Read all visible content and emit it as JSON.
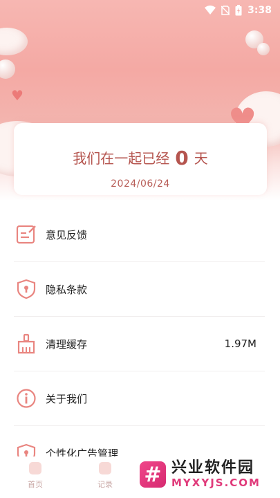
{
  "status_bar": {
    "time": "3:38"
  },
  "hero": {
    "together_prefix": "我们在一起已经",
    "days_count": "0",
    "together_suffix": "天",
    "start_date": "2024/06/24"
  },
  "menu": [
    {
      "label": "意见反馈",
      "icon": "feedback-edit-icon",
      "value": ""
    },
    {
      "label": "隐私条款",
      "icon": "privacy-shield-icon",
      "value": ""
    },
    {
      "label": "清理缓存",
      "icon": "broom-icon",
      "value": "1.97M"
    },
    {
      "label": "关于我们",
      "icon": "info-icon",
      "value": ""
    },
    {
      "label": "个性化广告管理",
      "icon": "ad-shield-icon",
      "value": ""
    }
  ],
  "tabs": [
    {
      "label": "首页",
      "icon": "home-icon"
    },
    {
      "label": "记录",
      "icon": "record-icon"
    }
  ],
  "watermark": {
    "logo_char": "#",
    "title": "兴业软件园",
    "subtitle": "MYXYJS.COM"
  },
  "colors": {
    "accent": "#e98580",
    "text_accent": "#b5554f"
  }
}
